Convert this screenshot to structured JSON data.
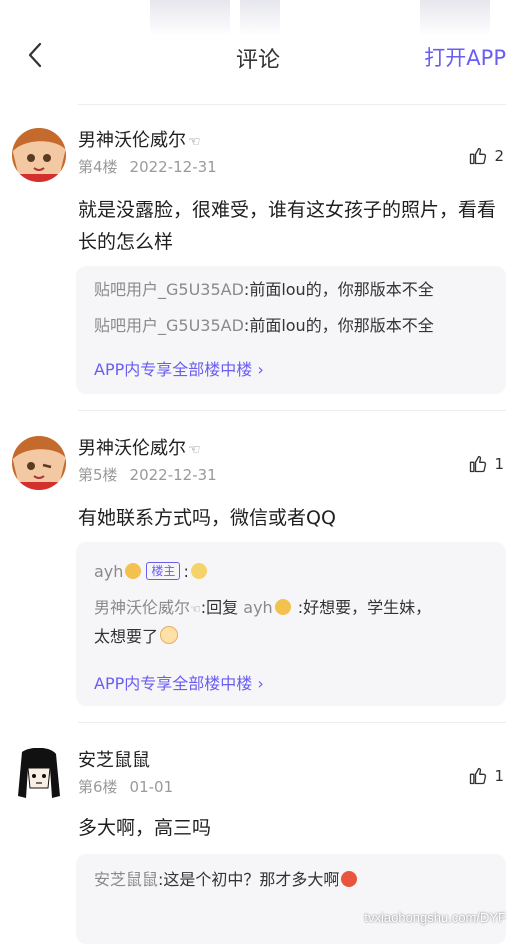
{
  "header": {
    "title": "评论",
    "open_app": "打开APP",
    "accent": "#6a5df2"
  },
  "comments": [
    {
      "user": "男神沃伦威尔",
      "hand": "☜",
      "floor": "第4楼",
      "date": "2022-12-31",
      "likes": "2",
      "text": "就是没露脸，很难受，谁有这女孩子的照片，看看长的怎么样",
      "replies": [
        {
          "user": "贴吧用户_G5U35AD",
          "text": ":前面lou的，你那版本不全"
        },
        {
          "user": "贴吧用户_G5U35AD",
          "text": ":前面lou的，你那版本不全"
        }
      ],
      "more": "APP内专享全部楼中楼 ›"
    },
    {
      "user": "男神沃伦威尔",
      "hand": "☜",
      "floor": "第5楼",
      "date": "2022-12-31",
      "likes": "1",
      "text": "有她联系方式吗，微信或者QQ",
      "replies": [
        {
          "user": "ayh",
          "badge": "楼主",
          "text": ":"
        },
        {
          "user": "男神沃伦威尔",
          "hand": "☜",
          "text1": ":回复 ",
          "mention": "ayh",
          "text2": " :好想要，学生妹，",
          "text3": "太想要了"
        }
      ],
      "more": "APP内专享全部楼中楼 ›"
    },
    {
      "user": "安芝鼠鼠",
      "floor": "第6楼",
      "date": "01-01",
      "likes": "1",
      "text": "多大啊，高三吗",
      "replies": [
        {
          "user": "安芝鼠鼠",
          "text": ":这是个初中？那才多大啊"
        }
      ]
    }
  ],
  "watermark": "tvxiaohongshu.com/DYF",
  "icons": {
    "back": "chevron-left-icon",
    "like": "thumbs-up-icon"
  }
}
